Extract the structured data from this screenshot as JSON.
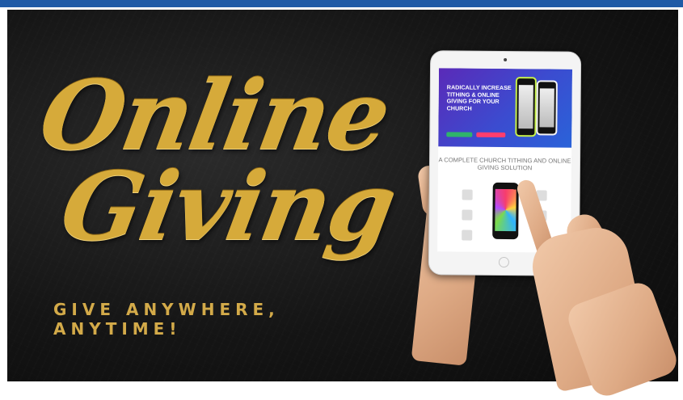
{
  "title": {
    "line1": "Online",
    "line2": "Giving"
  },
  "tagline": "GIVE ANYWHERE, ANYTIME!",
  "tablet": {
    "hero_heading": "RADICALLY INCREASE TITHING & ONLINE GIVING FOR YOUR CHURCH",
    "section_heading": "A COMPLETE CHURCH TITHING AND ONLINE GIVING SOLUTION"
  },
  "colors": {
    "topbar": "#1f5aa6",
    "gold": "#d6aa3a",
    "background": "#151515"
  }
}
